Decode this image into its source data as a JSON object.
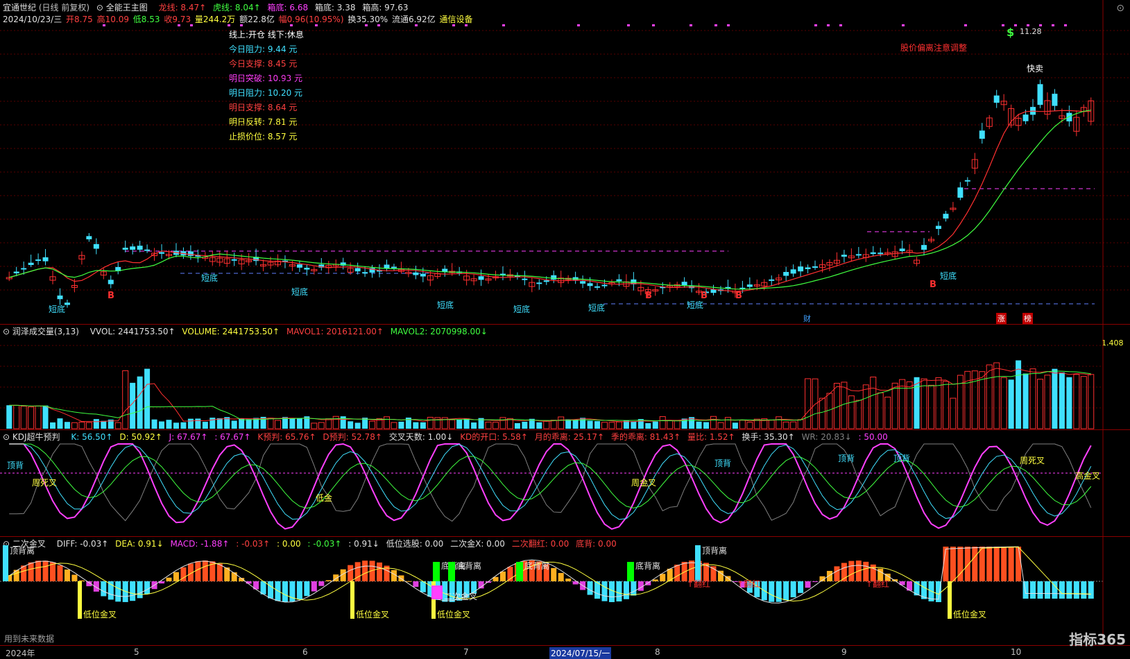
{
  "header": {
    "stock": "宜通世纪",
    "mode": "(日线 前复权)",
    "indicator": "全能王主图",
    "longline": "龙线: 8.47↑",
    "tigerline": "虎线: 8.04↑",
    "boxbottom": "箱底: 6.68",
    "boxbottom2": "箱底: 3.38",
    "boxtop": "箱高: 97.63"
  },
  "quote": {
    "date": "2024/10/23/三",
    "open": "开8.75",
    "high": "高10.09",
    "low": "低8.53",
    "close": "收9.73",
    "vol": "量244.2万",
    "amount": "额22.8亿",
    "change": "幅0.96(10.95%)",
    "turnover": "换35.30%",
    "float": "流通6.92亿",
    "sector": "通信设备"
  },
  "info": [
    {
      "label": "线上:开仓  线下:休息",
      "color": "#ffffff"
    },
    {
      "label": "今日阻力:  9.44 元",
      "color": "#40e0ff"
    },
    {
      "label": "今日支撑:  8.45 元",
      "color": "#ff4040"
    },
    {
      "label": "明日突破:  10.93 元",
      "color": "#ff40ff"
    },
    {
      "label": "明日阻力:  10.20 元",
      "color": "#40e0ff"
    },
    {
      "label": "明日支撑:  8.64 元",
      "color": "#ff4040"
    },
    {
      "label": "明日反转:  7.81 元",
      "color": "#ffff40"
    },
    {
      "label": "止损价位:  8.57 元",
      "color": "#ffff40"
    }
  ],
  "main_annotations": {
    "warn": "股价偏离注意调整",
    "sell": "快卖",
    "peak": "11.28",
    "dollar": "$",
    "b": "B",
    "dd": "短底",
    "cai": "财",
    "zhang": "涨",
    "bang": "榜"
  },
  "vol_legend": {
    "name": "润泽成交量(3,13)",
    "vvol": "VVOL: 2441753.50↑",
    "volume": "VOLUME: 2441753.50↑",
    "mavol1": "MAVOL1: 2016121.00↑",
    "mavol2": "MAVOL2: 2070998.00↓",
    "scale": "1.408"
  },
  "kdj_legend": {
    "name": "KDJ超牛预判",
    "k": "K: 56.50↑",
    "d": "D: 50.92↑",
    "j": "J: 67.67↑",
    "j2": ": 67.67↑",
    "kpre": "K预判: 65.76↑",
    "dpre": "D预判: 52.78↑",
    "cross": "交叉天数: 1.00↓",
    "kdopen": "KD的开口: 5.58↑",
    "month": "月的乖离: 25.17↑",
    "season": "季的乖离: 81.43↑",
    "ratio": "量比: 1.52↑",
    "hs": "换手: 35.30↑",
    "wr": "WR: 20.83↓",
    "fifty": ": 50.00"
  },
  "kdj_labels": {
    "top": "顶背",
    "weekdead": "周死叉",
    "weekgold": "周金叉",
    "lowgold": "低金",
    "highgold": "高金叉",
    "weekdead2": "周死叉"
  },
  "macd_legend": {
    "name": "二次金叉",
    "diff": "DIFF: -0.03↑",
    "dea": "DEA: 0.91↓",
    "macd": "MACD: -1.88↑",
    "a": ": -0.03↑",
    "b": ": 0.00",
    "c": ": -0.03↑",
    "d": ": 0.91↓",
    "low": "低位选股: 0.00",
    "second": "二次金X: 0.00",
    "flip": "二次翻红: 0.00",
    "bottom": "底背: 0.00"
  },
  "macd_labels": {
    "topdiv": "顶背离",
    "botdiv": "底背离",
    "lowgold": "低位金叉",
    "flipred": "翻红",
    "second": "二次金叉"
  },
  "axis": {
    "labels": [
      "2024年",
      "5",
      "6",
      "7",
      "2024/07/15/一",
      "8",
      "9",
      "10"
    ]
  },
  "footer": {
    "hint": "用到未来数据",
    "brand": "指标365"
  }
}
